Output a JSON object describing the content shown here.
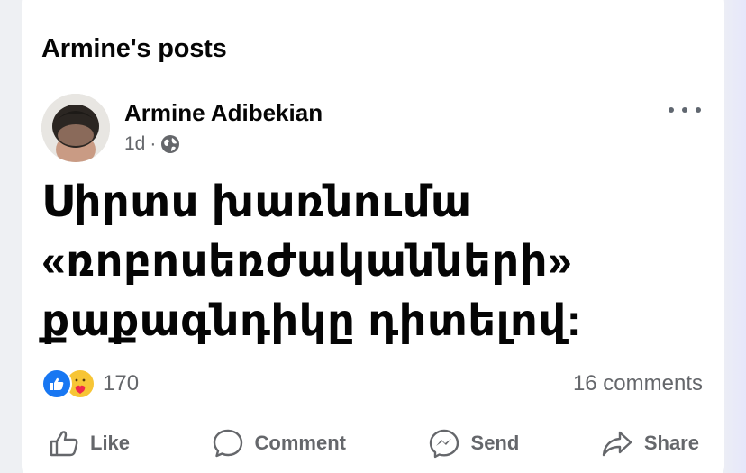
{
  "section": {
    "title": "Armine's posts"
  },
  "post": {
    "author": "Armine Adibekian",
    "time": "1d",
    "separator": "·",
    "text": "Սիրտս խառնումա\n«ռոբոսեռժականների»\nքաքագնդիկը դիտելով:",
    "reactions_count": "170",
    "comments_label": "16 comments"
  },
  "actions": {
    "like": "Like",
    "comment": "Comment",
    "send": "Send",
    "share": "Share"
  },
  "icons": {
    "privacy": "globe-icon",
    "menu": "more-horizontal-icon",
    "reaction_1": "like-reaction-icon",
    "reaction_2": "care-reaction-icon"
  },
  "colors": {
    "accent": "#1877f2",
    "secondary_text": "#65676b",
    "primary_text": "#050505"
  }
}
